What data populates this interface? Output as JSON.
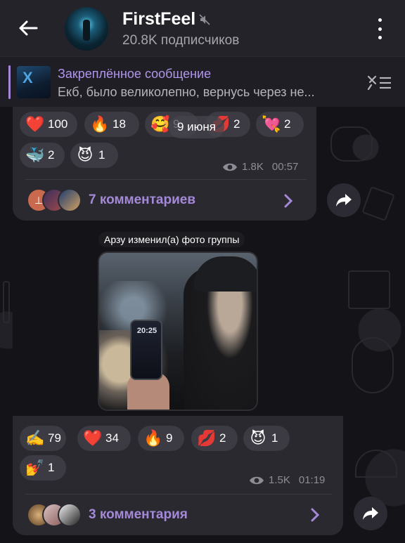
{
  "header": {
    "title": "FirstFeel",
    "subtitle": "20.8K подписчиков"
  },
  "pinned": {
    "title": "Закреплённое сообщение",
    "text": "Екб, было великолепно, вернусь через не..."
  },
  "date_chip": "9 июня",
  "post1": {
    "reactions": [
      {
        "emoji": "❤️",
        "count": "100"
      },
      {
        "emoji": "🔥",
        "count": "18"
      },
      {
        "emoji": "🥰",
        "count": "9"
      },
      {
        "emoji": "💋",
        "count": "2"
      },
      {
        "emoji": "💘",
        "count": "2"
      },
      {
        "emoji": "🐳",
        "count": "2"
      },
      {
        "emoji": "😈",
        "count": "1"
      }
    ],
    "views": "1.8K",
    "time": "00:57",
    "comments_label": "7 комментариев"
  },
  "post2": {
    "service_text": "Арзу изменил(а) фото группы",
    "phone_text": "20:25",
    "reactions": [
      {
        "emoji": "✍️",
        "count": "79"
      },
      {
        "emoji": "❤️",
        "count": "34"
      },
      {
        "emoji": "🔥",
        "count": "9"
      },
      {
        "emoji": "💋",
        "count": "2"
      },
      {
        "emoji": "😈",
        "count": "1"
      },
      {
        "emoji": "💅",
        "count": "1"
      }
    ],
    "views": "1.5K",
    "time": "01:19",
    "comments_label": "3 комментария"
  },
  "colors": {
    "accent": "#a489d8",
    "header_bg": "#242329",
    "bubble_bg": "#2a2930",
    "reaction_bg": "#3c3a42"
  }
}
